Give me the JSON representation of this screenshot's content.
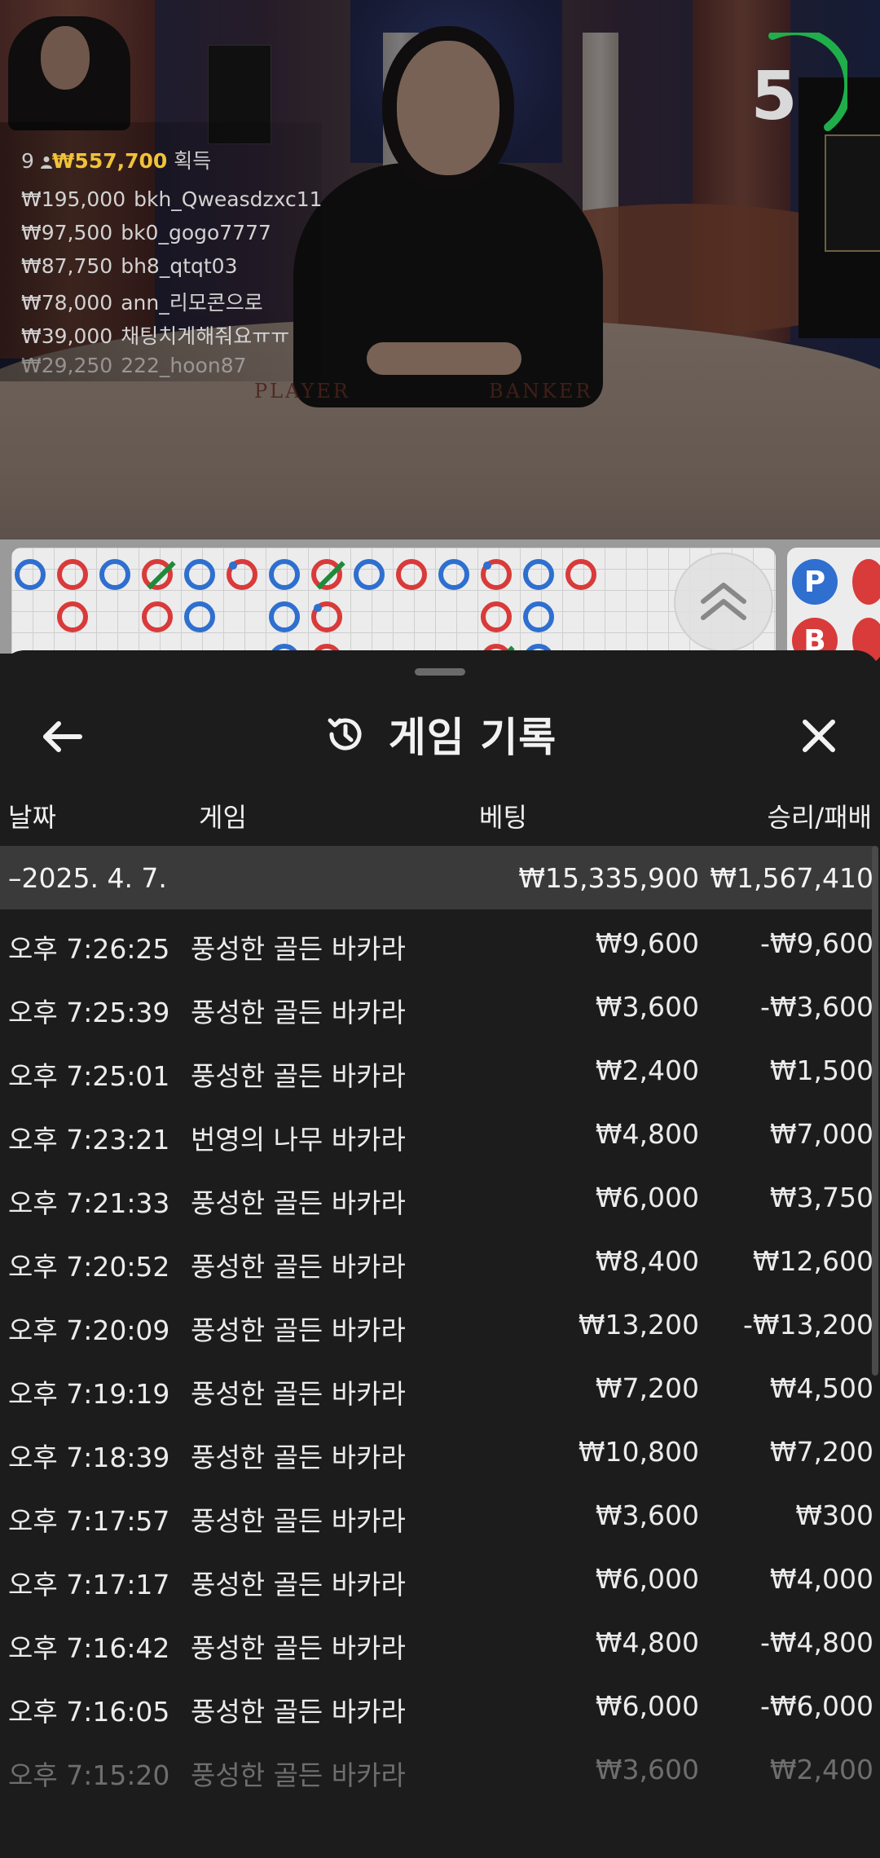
{
  "live": {
    "countdown": "5",
    "table_labels": {
      "player": "PLAYER",
      "banker": "BANKER"
    },
    "winners": {
      "count": "9",
      "total": "₩557,700",
      "total_suffix": "획득",
      "list": [
        {
          "amount": "₩195,000",
          "user": "bkh_Qweasdzxc11"
        },
        {
          "amount": "₩97,500",
          "user": "bk0_gogo7777"
        },
        {
          "amount": "₩87,750",
          "user": "bh8_qtqt03"
        },
        {
          "amount": "₩78,000",
          "user": "ann_리모콘으로"
        },
        {
          "amount": "₩39,000",
          "user": "채팅치게해줘요ㅠㅠ"
        },
        {
          "amount": "₩29,250",
          "user": "222_hoon87"
        }
      ]
    }
  },
  "roads": {
    "side_labels": {
      "player": "P",
      "banker": "B"
    },
    "colors": {
      "player": "#2e6fd0",
      "banker": "#d93a3a",
      "tie": "#1f8a3a"
    }
  },
  "history": {
    "title": "게임 기록",
    "columns": {
      "date": "날짜",
      "game": "게임",
      "bet": "베팅",
      "result": "승리/패배"
    },
    "summary": {
      "date": "–2025. 4. 7.",
      "bet": "₩15,335,900",
      "result": "₩1,567,410"
    },
    "rows": [
      {
        "time": "오후 7:26:25",
        "game": "풍성한 골든 바카라",
        "bet": "₩9,600",
        "result": "-₩9,600"
      },
      {
        "time": "오후 7:25:39",
        "game": "풍성한 골든 바카라",
        "bet": "₩3,600",
        "result": "-₩3,600"
      },
      {
        "time": "오후 7:25:01",
        "game": "풍성한 골든 바카라",
        "bet": "₩2,400",
        "result": "₩1,500"
      },
      {
        "time": "오후 7:23:21",
        "game": "번영의 나무 바카라",
        "bet": "₩4,800",
        "result": "₩7,000"
      },
      {
        "time": "오후 7:21:33",
        "game": "풍성한 골든 바카라",
        "bet": "₩6,000",
        "result": "₩3,750"
      },
      {
        "time": "오후 7:20:52",
        "game": "풍성한 골든 바카라",
        "bet": "₩8,400",
        "result": "₩12,600"
      },
      {
        "time": "오후 7:20:09",
        "game": "풍성한 골든 바카라",
        "bet": "₩13,200",
        "result": "-₩13,200"
      },
      {
        "time": "오후 7:19:19",
        "game": "풍성한 골든 바카라",
        "bet": "₩7,200",
        "result": "₩4,500"
      },
      {
        "time": "오후 7:18:39",
        "game": "풍성한 골든 바카라",
        "bet": "₩10,800",
        "result": "₩7,200"
      },
      {
        "time": "오후 7:17:57",
        "game": "풍성한 골든 바카라",
        "bet": "₩3,600",
        "result": "₩300"
      },
      {
        "time": "오후 7:17:17",
        "game": "풍성한 골든 바카라",
        "bet": "₩6,000",
        "result": "₩4,000"
      },
      {
        "time": "오후 7:16:42",
        "game": "풍성한 골든 바카라",
        "bet": "₩4,800",
        "result": "-₩4,800"
      },
      {
        "time": "오후 7:16:05",
        "game": "풍성한 골든 바카라",
        "bet": "₩6,000",
        "result": "-₩6,000"
      },
      {
        "time": "오후 7:15:20",
        "game": "풍성한 골든 바카라",
        "bet": "₩3,600",
        "result": "₩2,400"
      }
    ]
  },
  "icons": {
    "back": "back-arrow-icon",
    "history": "history-clock-icon",
    "close": "close-icon",
    "expand": "chevron-double-up-icon",
    "winners_person": "person-icon"
  }
}
